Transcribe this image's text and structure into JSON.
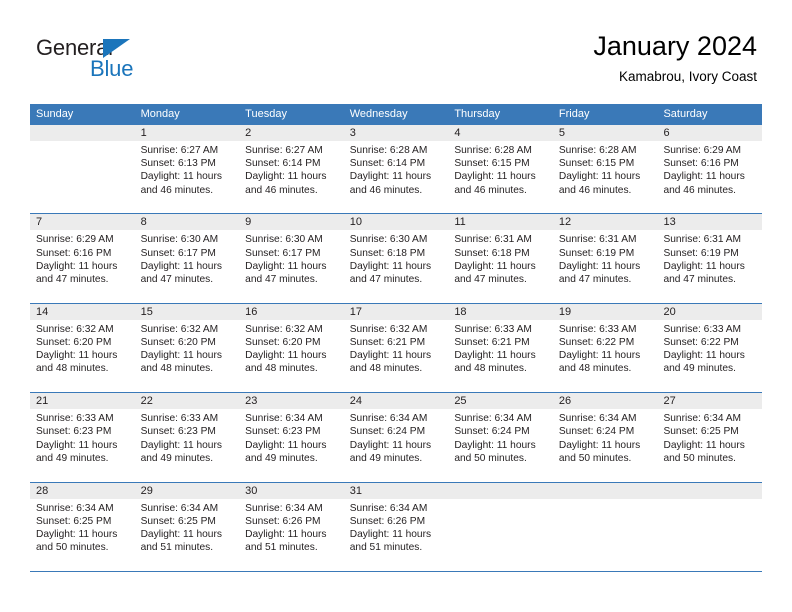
{
  "brand": {
    "name_part1": "General",
    "name_part2": "Blue",
    "accent_color": "#1b75bb"
  },
  "header": {
    "title": "January 2024",
    "subtitle": "Kamabrou, Ivory Coast"
  },
  "calendar": {
    "header_color": "#3a79b8",
    "weekdays": [
      "Sunday",
      "Monday",
      "Tuesday",
      "Wednesday",
      "Thursday",
      "Friday",
      "Saturday"
    ],
    "weeks": [
      [
        {
          "day": "",
          "sunrise": "",
          "sunset": "",
          "daylight": ""
        },
        {
          "day": "1",
          "sunrise": "Sunrise: 6:27 AM",
          "sunset": "Sunset: 6:13 PM",
          "daylight": "Daylight: 11 hours and 46 minutes."
        },
        {
          "day": "2",
          "sunrise": "Sunrise: 6:27 AM",
          "sunset": "Sunset: 6:14 PM",
          "daylight": "Daylight: 11 hours and 46 minutes."
        },
        {
          "day": "3",
          "sunrise": "Sunrise: 6:28 AM",
          "sunset": "Sunset: 6:14 PM",
          "daylight": "Daylight: 11 hours and 46 minutes."
        },
        {
          "day": "4",
          "sunrise": "Sunrise: 6:28 AM",
          "sunset": "Sunset: 6:15 PM",
          "daylight": "Daylight: 11 hours and 46 minutes."
        },
        {
          "day": "5",
          "sunrise": "Sunrise: 6:28 AM",
          "sunset": "Sunset: 6:15 PM",
          "daylight": "Daylight: 11 hours and 46 minutes."
        },
        {
          "day": "6",
          "sunrise": "Sunrise: 6:29 AM",
          "sunset": "Sunset: 6:16 PM",
          "daylight": "Daylight: 11 hours and 46 minutes."
        }
      ],
      [
        {
          "day": "7",
          "sunrise": "Sunrise: 6:29 AM",
          "sunset": "Sunset: 6:16 PM",
          "daylight": "Daylight: 11 hours and 47 minutes."
        },
        {
          "day": "8",
          "sunrise": "Sunrise: 6:30 AM",
          "sunset": "Sunset: 6:17 PM",
          "daylight": "Daylight: 11 hours and 47 minutes."
        },
        {
          "day": "9",
          "sunrise": "Sunrise: 6:30 AM",
          "sunset": "Sunset: 6:17 PM",
          "daylight": "Daylight: 11 hours and 47 minutes."
        },
        {
          "day": "10",
          "sunrise": "Sunrise: 6:30 AM",
          "sunset": "Sunset: 6:18 PM",
          "daylight": "Daylight: 11 hours and 47 minutes."
        },
        {
          "day": "11",
          "sunrise": "Sunrise: 6:31 AM",
          "sunset": "Sunset: 6:18 PM",
          "daylight": "Daylight: 11 hours and 47 minutes."
        },
        {
          "day": "12",
          "sunrise": "Sunrise: 6:31 AM",
          "sunset": "Sunset: 6:19 PM",
          "daylight": "Daylight: 11 hours and 47 minutes."
        },
        {
          "day": "13",
          "sunrise": "Sunrise: 6:31 AM",
          "sunset": "Sunset: 6:19 PM",
          "daylight": "Daylight: 11 hours and 47 minutes."
        }
      ],
      [
        {
          "day": "14",
          "sunrise": "Sunrise: 6:32 AM",
          "sunset": "Sunset: 6:20 PM",
          "daylight": "Daylight: 11 hours and 48 minutes."
        },
        {
          "day": "15",
          "sunrise": "Sunrise: 6:32 AM",
          "sunset": "Sunset: 6:20 PM",
          "daylight": "Daylight: 11 hours and 48 minutes."
        },
        {
          "day": "16",
          "sunrise": "Sunrise: 6:32 AM",
          "sunset": "Sunset: 6:20 PM",
          "daylight": "Daylight: 11 hours and 48 minutes."
        },
        {
          "day": "17",
          "sunrise": "Sunrise: 6:32 AM",
          "sunset": "Sunset: 6:21 PM",
          "daylight": "Daylight: 11 hours and 48 minutes."
        },
        {
          "day": "18",
          "sunrise": "Sunrise: 6:33 AM",
          "sunset": "Sunset: 6:21 PM",
          "daylight": "Daylight: 11 hours and 48 minutes."
        },
        {
          "day": "19",
          "sunrise": "Sunrise: 6:33 AM",
          "sunset": "Sunset: 6:22 PM",
          "daylight": "Daylight: 11 hours and 48 minutes."
        },
        {
          "day": "20",
          "sunrise": "Sunrise: 6:33 AM",
          "sunset": "Sunset: 6:22 PM",
          "daylight": "Daylight: 11 hours and 49 minutes."
        }
      ],
      [
        {
          "day": "21",
          "sunrise": "Sunrise: 6:33 AM",
          "sunset": "Sunset: 6:23 PM",
          "daylight": "Daylight: 11 hours and 49 minutes."
        },
        {
          "day": "22",
          "sunrise": "Sunrise: 6:33 AM",
          "sunset": "Sunset: 6:23 PM",
          "daylight": "Daylight: 11 hours and 49 minutes."
        },
        {
          "day": "23",
          "sunrise": "Sunrise: 6:34 AM",
          "sunset": "Sunset: 6:23 PM",
          "daylight": "Daylight: 11 hours and 49 minutes."
        },
        {
          "day": "24",
          "sunrise": "Sunrise: 6:34 AM",
          "sunset": "Sunset: 6:24 PM",
          "daylight": "Daylight: 11 hours and 49 minutes."
        },
        {
          "day": "25",
          "sunrise": "Sunrise: 6:34 AM",
          "sunset": "Sunset: 6:24 PM",
          "daylight": "Daylight: 11 hours and 50 minutes."
        },
        {
          "day": "26",
          "sunrise": "Sunrise: 6:34 AM",
          "sunset": "Sunset: 6:24 PM",
          "daylight": "Daylight: 11 hours and 50 minutes."
        },
        {
          "day": "27",
          "sunrise": "Sunrise: 6:34 AM",
          "sunset": "Sunset: 6:25 PM",
          "daylight": "Daylight: 11 hours and 50 minutes."
        }
      ],
      [
        {
          "day": "28",
          "sunrise": "Sunrise: 6:34 AM",
          "sunset": "Sunset: 6:25 PM",
          "daylight": "Daylight: 11 hours and 50 minutes."
        },
        {
          "day": "29",
          "sunrise": "Sunrise: 6:34 AM",
          "sunset": "Sunset: 6:25 PM",
          "daylight": "Daylight: 11 hours and 51 minutes."
        },
        {
          "day": "30",
          "sunrise": "Sunrise: 6:34 AM",
          "sunset": "Sunset: 6:26 PM",
          "daylight": "Daylight: 11 hours and 51 minutes."
        },
        {
          "day": "31",
          "sunrise": "Sunrise: 6:34 AM",
          "sunset": "Sunset: 6:26 PM",
          "daylight": "Daylight: 11 hours and 51 minutes."
        },
        {
          "day": "",
          "sunrise": "",
          "sunset": "",
          "daylight": ""
        },
        {
          "day": "",
          "sunrise": "",
          "sunset": "",
          "daylight": ""
        },
        {
          "day": "",
          "sunrise": "",
          "sunset": "",
          "daylight": ""
        }
      ]
    ]
  }
}
